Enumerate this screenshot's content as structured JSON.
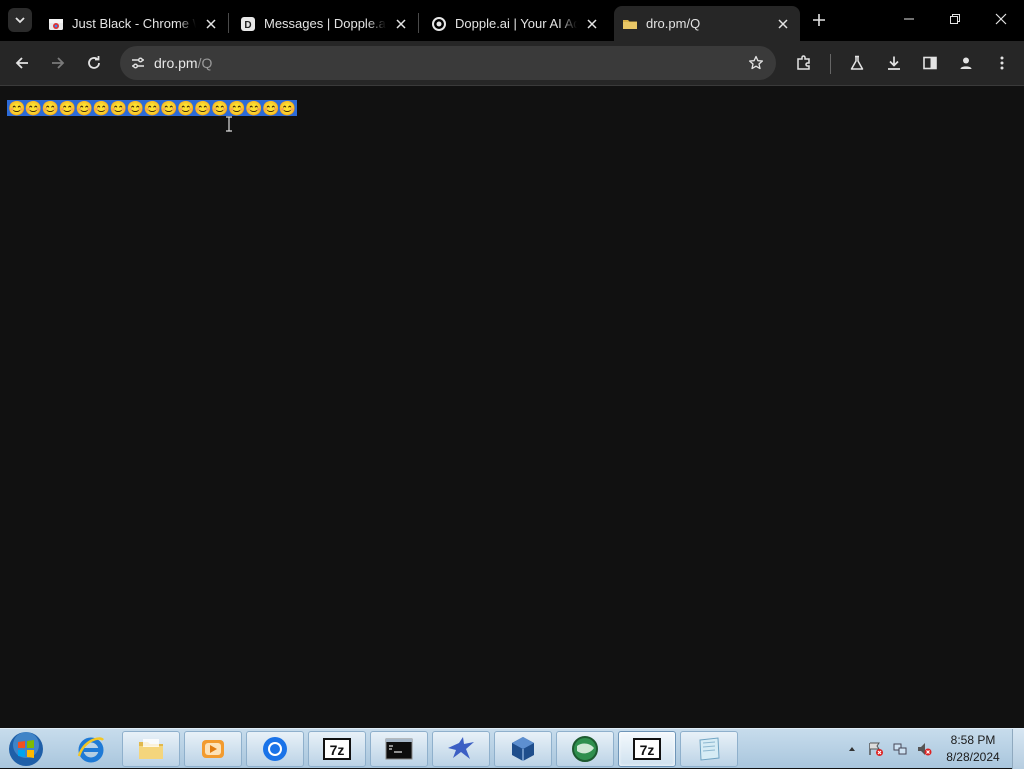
{
  "browser": {
    "tabs": [
      {
        "title": "Just Black - Chrome Web Store",
        "favicon": "chrome-web-store-icon",
        "active": false
      },
      {
        "title": "Messages | Dopple.ai",
        "favicon": "dopple-icon",
        "active": false
      },
      {
        "title": "Dopple.ai | Your AI Adventure",
        "favicon": "dopple-swirl-icon",
        "active": false
      },
      {
        "title": "dro.pm/Q",
        "favicon": "folder-icon",
        "active": true
      }
    ],
    "address": {
      "host": "dro.pm",
      "path": "/Q"
    }
  },
  "page": {
    "selected_text": "😊😊😊😊😊😊😊😊😊😊😊😊😊😊😊😊😊"
  },
  "taskbar": {
    "apps": [
      {
        "name": "internet-explorer"
      },
      {
        "name": "file-explorer"
      },
      {
        "name": "media-player"
      },
      {
        "name": "chrome"
      },
      {
        "name": "7-zip",
        "label": "7z"
      },
      {
        "name": "command-prompt"
      },
      {
        "name": "bird-app"
      },
      {
        "name": "virtualbox"
      },
      {
        "name": "globe-app"
      },
      {
        "name": "7-zip-active",
        "label": "7z"
      },
      {
        "name": "notepad-like-app"
      }
    ],
    "clock": {
      "time": "8:58 PM",
      "date": "8/28/2024"
    }
  },
  "colors": {
    "selection": "#2c6bd8",
    "page_bg": "#111111",
    "toolbar_bg": "#262626",
    "tabstrip_bg": "#000000"
  }
}
